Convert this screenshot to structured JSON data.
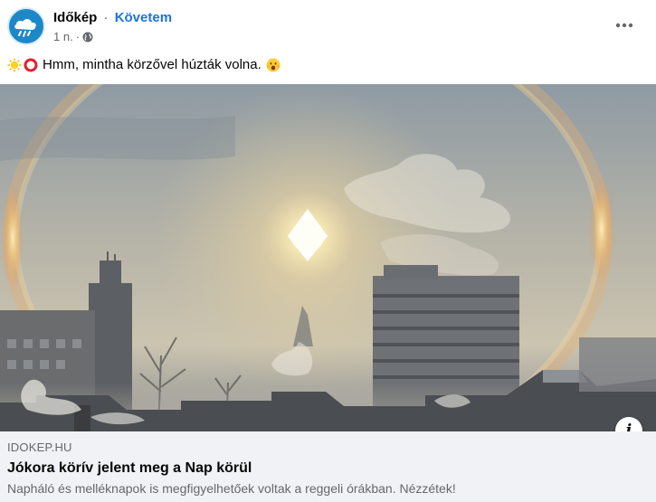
{
  "post": {
    "page_name": "Időkép",
    "separator": "·",
    "follow_label": "Követem",
    "time": "1 n.",
    "meta_separator": "·",
    "privacy_icon": "globe-icon",
    "more_icon": "more-horizontal-icon",
    "emojis": [
      "sun-emoji",
      "hollow-red-circle-emoji",
      "hushed-face-emoji"
    ],
    "text": "Hmm, mintha körzővel húzták volna."
  },
  "photo": {
    "description_icon": "info-icon",
    "info_label": "i"
  },
  "link": {
    "domain": "IDOKEP.HU",
    "title": "Jókora körív jelent meg a Nap körül",
    "description": "Napháló és melléknapok is megfigyelhetőek voltak a reggeli órákban. Nézzétek!"
  },
  "colors": {
    "accent": "#1b74e4",
    "secondary_text": "#65676b",
    "link_background": "#f0f2f5",
    "avatar_background": "#1e88c7"
  }
}
